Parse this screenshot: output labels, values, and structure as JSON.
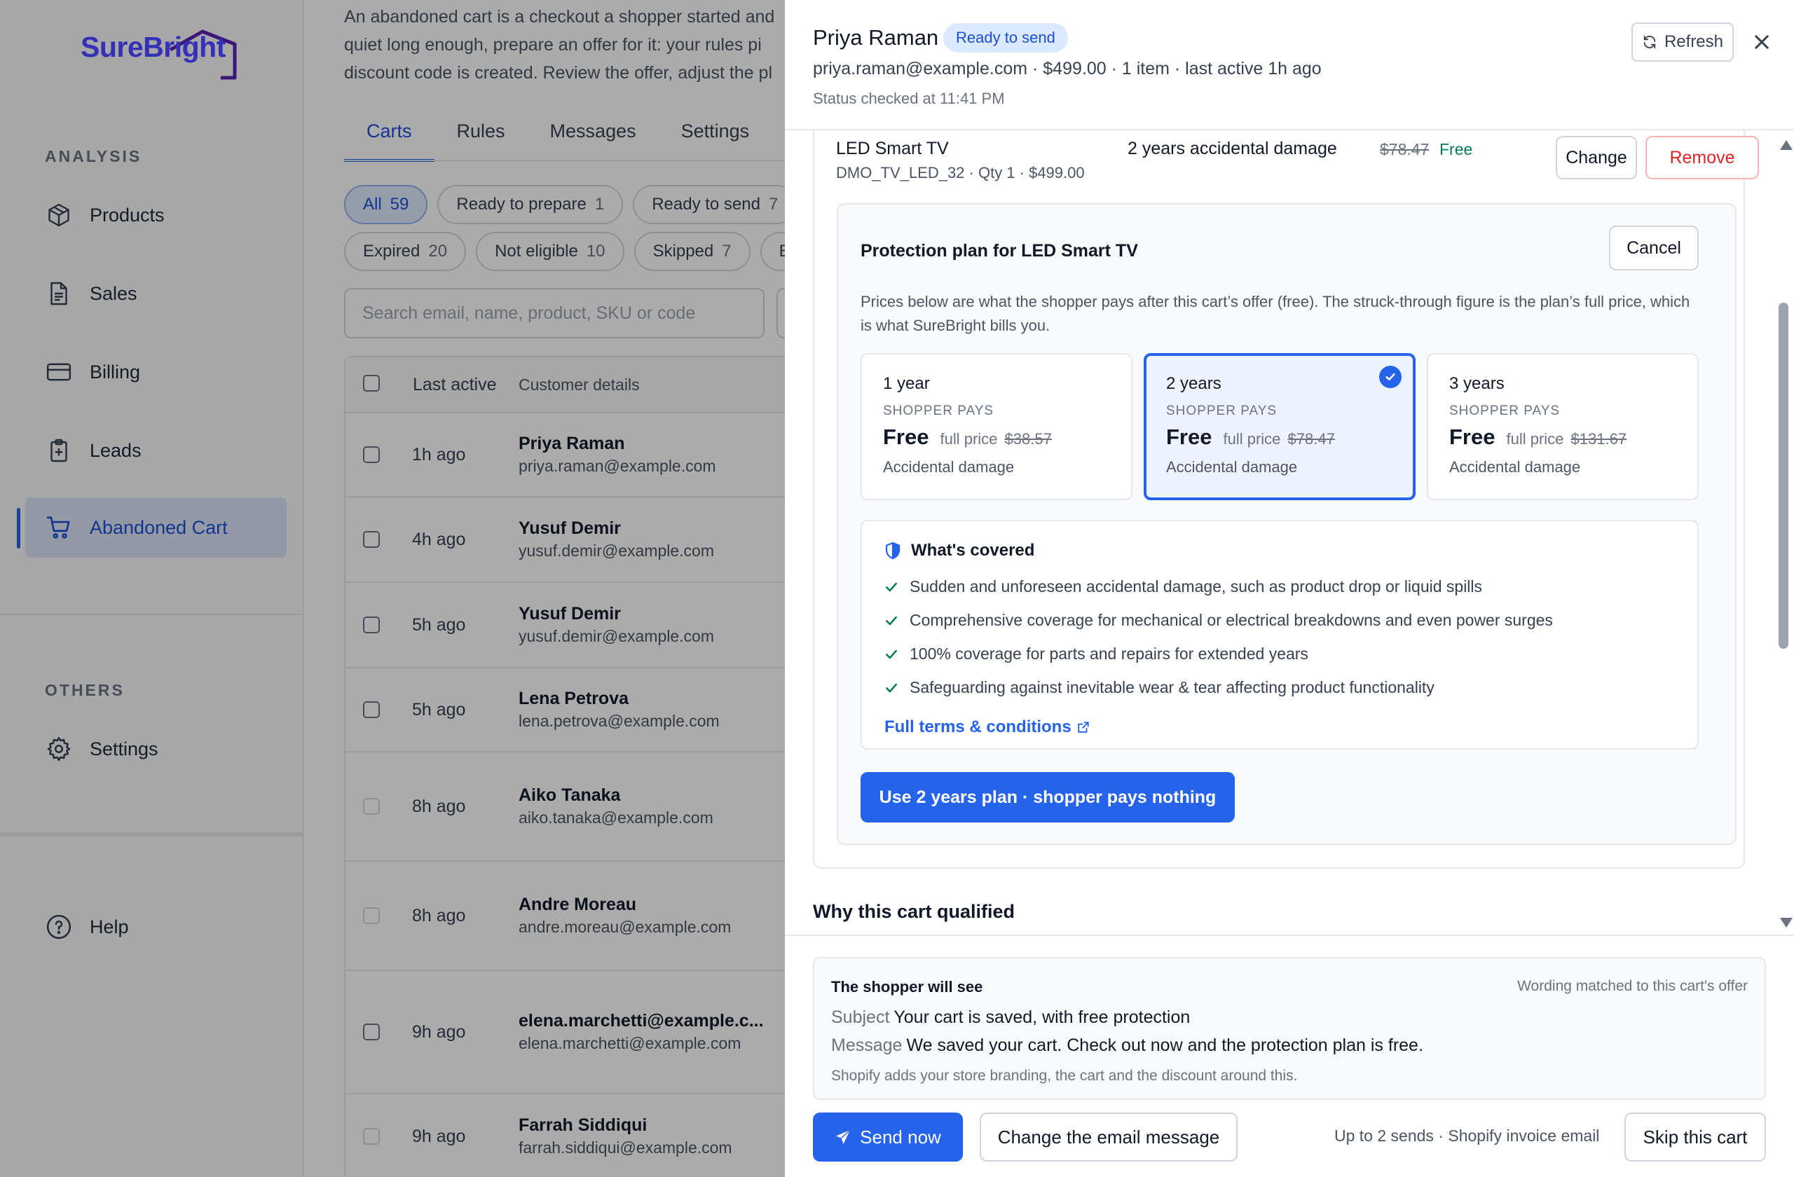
{
  "brand": {
    "name": "SureBright",
    "accent": "#2563eb",
    "logo_color": "#3430b8"
  },
  "sidebar": {
    "section_analysis": "ANALYSIS",
    "items": [
      {
        "label": "Products",
        "icon": "box-icon"
      },
      {
        "label": "Sales",
        "icon": "document-icon"
      },
      {
        "label": "Billing",
        "icon": "credit-card-icon"
      },
      {
        "label": "Leads",
        "icon": "clipboard-plus-icon"
      },
      {
        "label": "Abandoned Cart",
        "icon": "cart-icon",
        "active": true
      }
    ],
    "section_others": "OTHERS",
    "settings": "Settings",
    "help": "Help"
  },
  "main": {
    "intro": [
      "An abandoned cart is a checkout a shopper started and",
      "quiet long enough, prepare an offer for it: your rules pi",
      "discount code is created. Review the offer, adjust the pl"
    ],
    "tabs": [
      "Carts",
      "Rules",
      "Messages",
      "Settings"
    ],
    "chips_row1": [
      {
        "label": "All",
        "count": "59"
      },
      {
        "label": "Ready to prepare",
        "count": "1"
      },
      {
        "label": "Ready to send",
        "count": "7"
      }
    ],
    "chips_row2": [
      {
        "label": "Expired",
        "count": "20"
      },
      {
        "label": "Not eligible",
        "count": "10"
      },
      {
        "label": "Skipped",
        "count": "7"
      },
      {
        "label": "Bo",
        "count": ""
      }
    ],
    "search_placeholder": "Search email, name, product, SKU or code",
    "table": {
      "headers": {
        "last_active": "Last active",
        "customer": "Customer details"
      },
      "rows": [
        {
          "time": "1h ago",
          "name": "Priya Raman",
          "email": "priya.raman@example.com"
        },
        {
          "time": "4h ago",
          "name": "Yusuf Demir",
          "email": "yusuf.demir@example.com"
        },
        {
          "time": "5h ago",
          "name": "Yusuf Demir",
          "email": "yusuf.demir@example.com"
        },
        {
          "time": "5h ago",
          "name": "Lena Petrova",
          "email": "lena.petrova@example.com"
        },
        {
          "time": "8h ago",
          "name": "Aiko Tanaka",
          "email": "aiko.tanaka@example.com"
        },
        {
          "time": "8h ago",
          "name": "Andre Moreau",
          "email": "andre.moreau@example.com"
        },
        {
          "time": "9h ago",
          "name": "elena.marchetti@example.c...",
          "email": "elena.marchetti@example.com"
        },
        {
          "time": "9h ago",
          "name": "Farrah Siddiqui",
          "email": "farrah.siddiqui@example.com"
        }
      ]
    }
  },
  "drawer": {
    "name": "Priya Raman",
    "badge": "Ready to send",
    "meta": "priya.raman@example.com · $499.00 · 1 item · last active 1h ago",
    "status": "Status checked at 11:41 PM",
    "refresh": "Refresh",
    "product": {
      "name": "LED Smart TV",
      "sku": "DMO_TV_LED_32 · Qty 1 · $499.00",
      "plan": "2 years accidental damage",
      "full_price": "$78.47",
      "price": "Free",
      "change": "Change",
      "remove": "Remove"
    },
    "plan_panel": {
      "title": "Protection plan for LED Smart TV",
      "cancel": "Cancel",
      "desc": "Prices below are what the shopper pays after this cart’s offer (free). The struck-through figure is the plan’s full price, which is what SureBright bills you.",
      "options": [
        {
          "length": "1 year",
          "label": "SHOPPER PAYS",
          "price": "Free",
          "full_label": "full price",
          "full": "$38.57",
          "type": "Accidental damage"
        },
        {
          "length": "2 years",
          "label": "SHOPPER PAYS",
          "price": "Free",
          "full_label": "full price",
          "full": "$78.47",
          "type": "Accidental damage",
          "selected": true
        },
        {
          "length": "3 years",
          "label": "SHOPPER PAYS",
          "price": "Free",
          "full_label": "full price",
          "full": "$131.67",
          "type": "Accidental damage"
        }
      ],
      "covered_title": "What's covered",
      "covered": [
        "Sudden and unforeseen accidental damage, such as product drop or liquid spills",
        "Comprehensive coverage for mechanical or electrical breakdowns and even power surges",
        "100% coverage for parts and repairs for extended years",
        "Safeguarding against inevitable wear & tear affecting product functionality"
      ],
      "terms": "Full terms & conditions",
      "use_button": "Use 2 years plan · shopper pays nothing"
    },
    "why": "Why this cart qualified",
    "preview": {
      "title": "The shopper will see",
      "note": "Wording matched to this cart's offer",
      "subject_label": "Subject",
      "subject": "Your cart is saved, with free protection",
      "message_label": "Message",
      "message": "We saved your cart. Check out now and the protection plan is free.",
      "foot": "Shopify adds your store branding, the cart and the discount around this."
    },
    "actions": {
      "send": "Send now",
      "change_msg": "Change the email message",
      "note": "Up to 2 sends · Shopify invoice email",
      "skip": "Skip this cart"
    }
  }
}
